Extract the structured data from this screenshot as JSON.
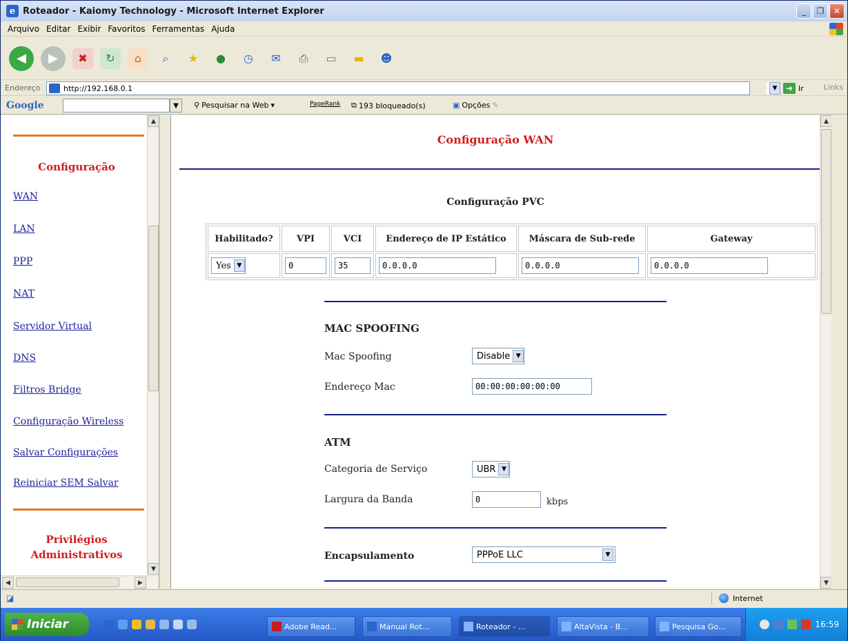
{
  "window": {
    "title": "Roteador - Kaiomy Technology - Microsoft Internet Explorer"
  },
  "menu": [
    "Arquivo",
    "Editar",
    "Exibir",
    "Favoritos",
    "Ferramentas",
    "Ajuda"
  ],
  "address": {
    "label": "Endereço",
    "url": "http://192.168.0.1",
    "go_label": "Ir",
    "links_label": "Links"
  },
  "google_toolbar": {
    "logo": "Google",
    "search_web": "Pesquisar na Web",
    "pagerank": "PageRank",
    "blocked": "193 bloqueado(s)",
    "options": "Opções"
  },
  "sidebar": {
    "heading": "Configuração",
    "items": [
      {
        "label": "WAN"
      },
      {
        "label": "LAN"
      },
      {
        "label": "PPP"
      },
      {
        "label": "NAT"
      },
      {
        "label": "Servidor Virtual"
      },
      {
        "label": "DNS"
      },
      {
        "label": "Filtros Bridge"
      },
      {
        "label": "Configuração Wireless"
      },
      {
        "label": "Salvar Configurações"
      },
      {
        "label": "Reiniciar SEM Salvar"
      }
    ],
    "heading2_line1": "Privilégios",
    "heading2_line2": "Administrativos"
  },
  "main": {
    "title": "Configuração WAN",
    "pvc_title": "Configuração PVC",
    "pvc_headers": [
      "Habilitado?",
      "VPI",
      "VCI",
      "Endereço de IP Estático",
      "Máscara de Sub-rede",
      "Gateway"
    ],
    "pvc_values": {
      "enabled": "Yes",
      "vpi": "0",
      "vci": "35",
      "ip": "0.0.0.0",
      "mask": "0.0.0.0",
      "gateway": "0.0.0.0"
    },
    "mac_section": "MAC SPOOFING",
    "mac_spoofing_label": "Mac Spoofing",
    "mac_spoofing_value": "Disable",
    "mac_address_label": "Endereço Mac",
    "mac_address_value": "00:00:00:00:00:00",
    "atm_section": "ATM",
    "service_category_label": "Categoria de Serviço",
    "service_category_value": "UBR",
    "bandwidth_label": "Largura da Banda",
    "bandwidth_value": "0",
    "bandwidth_unit": "kbps",
    "encapsulation_label": "Encapsulamento",
    "encapsulation_value": "PPPoE LLC"
  },
  "status": {
    "zone": "Internet"
  },
  "taskbar": {
    "start": "Iniciar",
    "tasks": [
      "Adobe Read...",
      "Manual Rot...",
      "Roteador - ...",
      "AltaVista - B...",
      "Pesquisa Go..."
    ],
    "clock": "16:59"
  }
}
